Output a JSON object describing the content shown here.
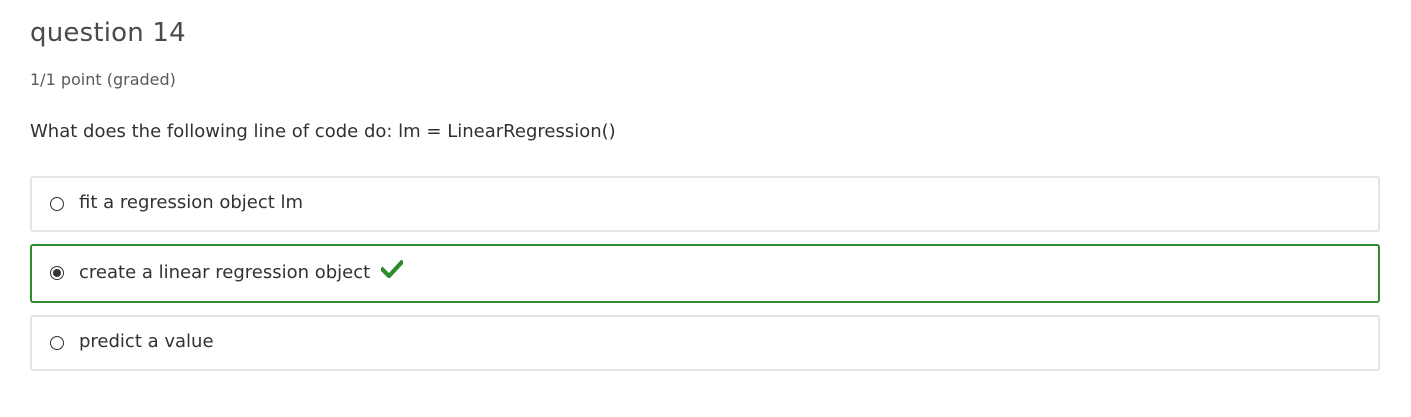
{
  "question": {
    "title": "question 14",
    "points": "1/1 point (graded)",
    "prompt": "What does the following line of code do: lm = LinearRegression()"
  },
  "choices": [
    {
      "label": "fit a regression object lm",
      "selected": false,
      "correct": false
    },
    {
      "label": "create a linear regression object",
      "selected": true,
      "correct": true
    },
    {
      "label": "predict a value",
      "selected": false,
      "correct": false
    }
  ],
  "colors": {
    "correct": "#2e8b2e",
    "border": "#e4e4e4",
    "text": "#313131"
  },
  "icons": {
    "correct_marker": "checkmark-icon",
    "unselected": "radio-empty",
    "selected": "radio-filled"
  }
}
